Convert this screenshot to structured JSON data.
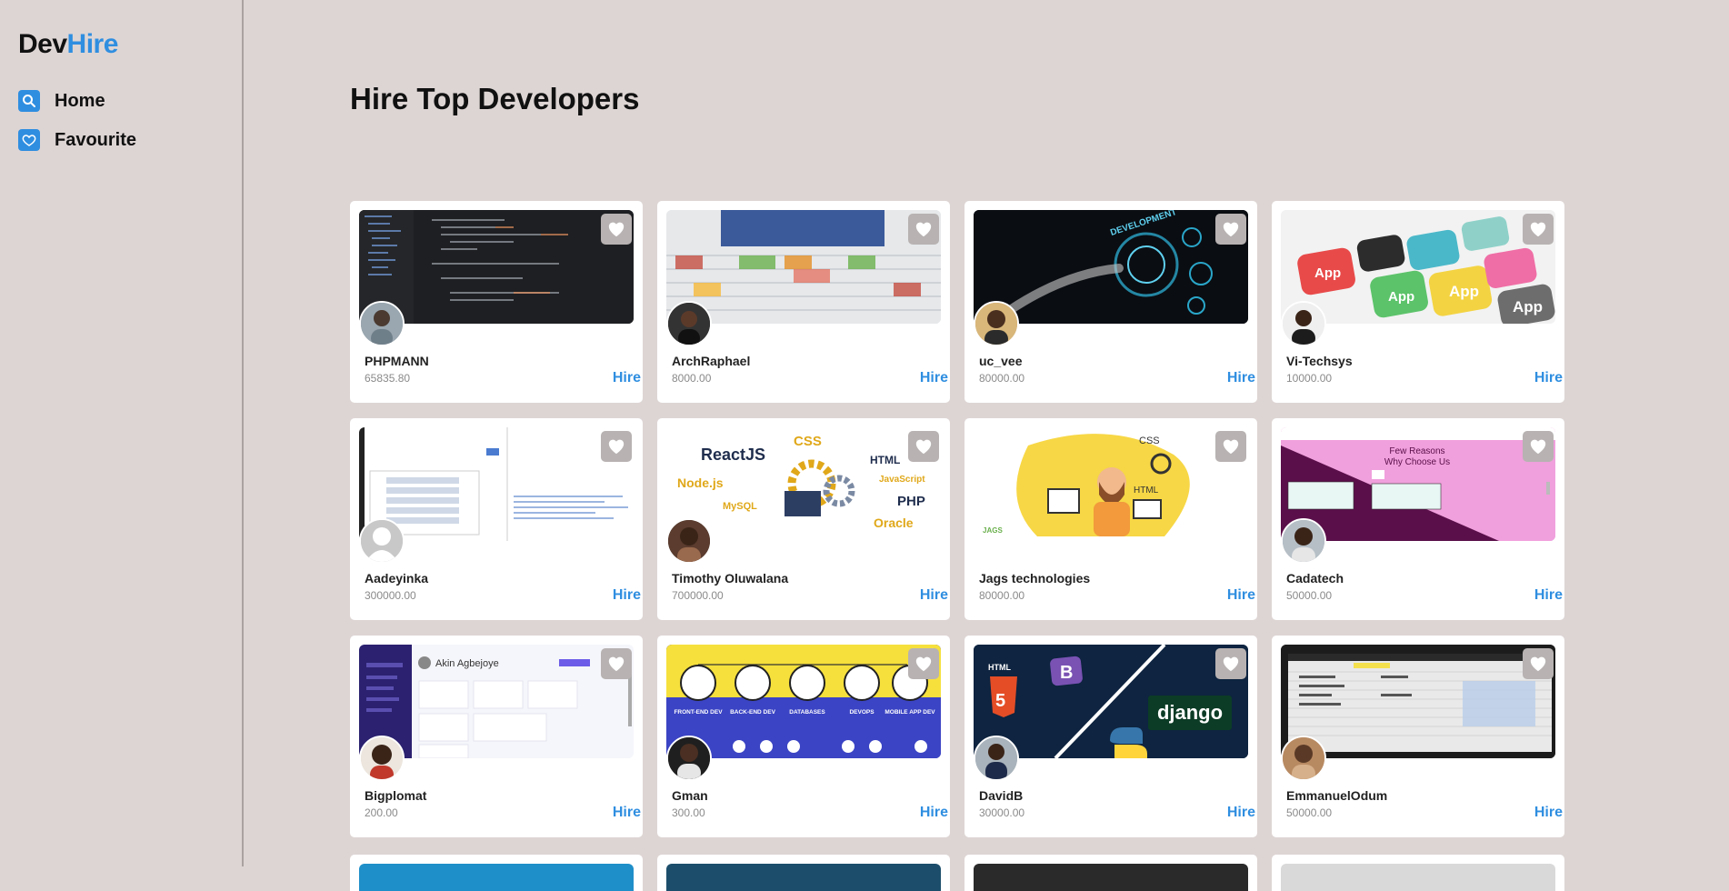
{
  "logo": {
    "part1": "Dev",
    "part2": "Hire"
  },
  "nav": [
    {
      "label": "Home",
      "icon": "search-icon"
    },
    {
      "label": "Favourite",
      "icon": "heart-icon"
    }
  ],
  "page_title": "Hire Top Developers",
  "accent_color": "#2f8ee0",
  "hire_label": "Hire",
  "developers": [
    {
      "name": "PHPMANN",
      "rate": "65835.80",
      "banner": "code-editor"
    },
    {
      "name": "ArchRaphael",
      "rate": "8000.00",
      "banner": "spreadsheet"
    },
    {
      "name": "uc_vee",
      "rate": "80000.00",
      "banner": "web-development"
    },
    {
      "name": "Vi-Techsys",
      "rate": "10000.00",
      "banner": "app-keys"
    },
    {
      "name": "Aadeyinka",
      "rate": "300000.00",
      "banner": "web-form"
    },
    {
      "name": "Timothy Oluwalana",
      "rate": "700000.00",
      "banner": "tech-stack"
    },
    {
      "name": "Jags technologies",
      "rate": "80000.00",
      "banner": "developer-illustration"
    },
    {
      "name": "Cadatech",
      "rate": "50000.00",
      "banner": "landing-page"
    },
    {
      "name": "Bigplomat",
      "rate": "200.00",
      "banner": "dashboard"
    },
    {
      "name": "Gman",
      "rate": "300.00",
      "banner": "dev-categories"
    },
    {
      "name": "DavidB",
      "rate": "30000.00",
      "banner": "django-html"
    },
    {
      "name": "EmmanuelOdum",
      "rate": "50000.00",
      "banner": "spreadsheet-dark"
    }
  ],
  "banner_texts": {
    "tech_stack": [
      "ReactJS",
      "CSS",
      "HTML",
      "Node.js",
      "JavaScript",
      "MySQL",
      "PHP",
      "Oracle"
    ],
    "landing": [
      "Few Reasons",
      "Why Choose Us"
    ],
    "dashboard_user": "Akin Agbejoye",
    "dev_categories": [
      "FRONT-END DEV",
      "BACK-END DEV",
      "DATABASES",
      "DEVOPS",
      "MOBILE APP DEV"
    ],
    "django": "django",
    "web_dev": "DEVELOPMENT",
    "app_key": "App",
    "jags": "JAGS"
  }
}
